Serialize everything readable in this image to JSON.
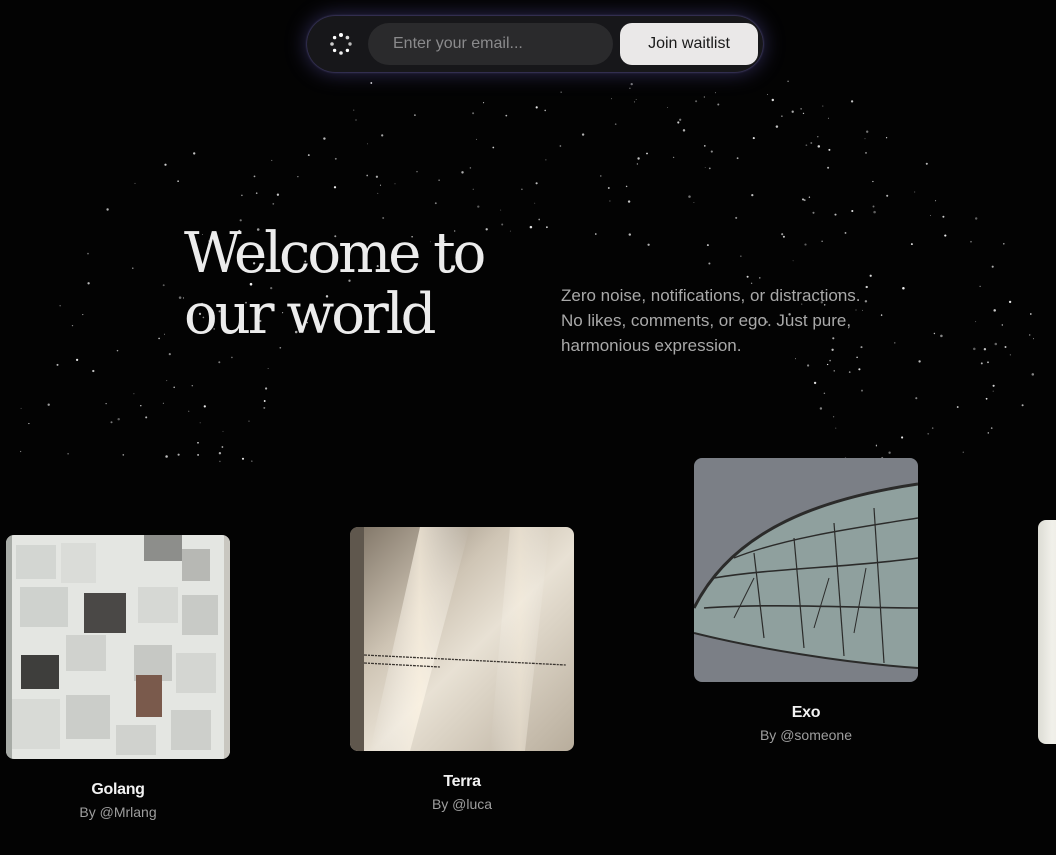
{
  "waitlist": {
    "email_placeholder": "Enter your email...",
    "button_label": "Join waitlist"
  },
  "hero": {
    "title_line1": "Welcome to",
    "title_line2": "our world",
    "tagline_line1": "Zero noise, notifications, or distractions.",
    "tagline_line2": "No likes, comments, or ego. Just pure,",
    "tagline_line3": "harmonious expression."
  },
  "cards": [
    {
      "title": "Golang",
      "author": "By @Mrlang",
      "image": "collage-thumbnail"
    },
    {
      "title": "Terra",
      "author": "By @luca",
      "image": "book-page-thumbnail"
    },
    {
      "title": "Exo",
      "author": "By @someone",
      "image": "insect-wing-thumbnail"
    }
  ],
  "icons": {
    "logo": "spinner-dots-icon"
  },
  "colors": {
    "background": "#030303",
    "glow": "#8c82ff",
    "button_bg": "#eae8e8"
  }
}
